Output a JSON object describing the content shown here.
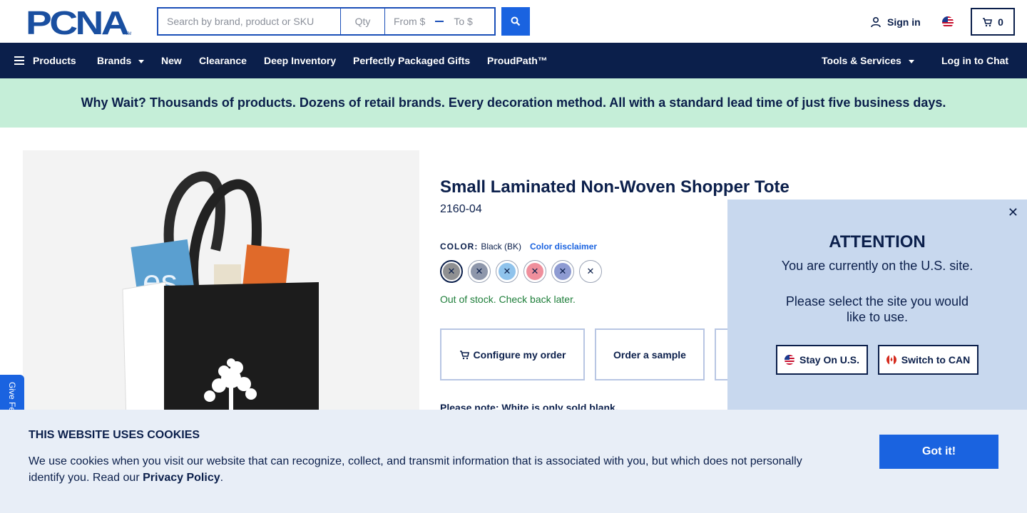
{
  "header": {
    "logo_text": "PCNA",
    "search_placeholder": "Search by brand, product or SKU",
    "qty_placeholder": "Qty",
    "price_from_placeholder": "From $",
    "price_to_placeholder": "To $",
    "sign_in_label": "Sign in",
    "cart_count": "0"
  },
  "nav": {
    "items": [
      "Products",
      "Brands",
      "New",
      "Clearance",
      "Deep Inventory",
      "Perfectly Packaged Gifts",
      "ProudPath™"
    ],
    "right_items": [
      "Tools & Services",
      "Log in to Chat"
    ]
  },
  "promo": {
    "text": "Why Wait? Thousands of products. Dozens of retail brands. Every decoration method. All with a standard lead time of just five business days."
  },
  "product": {
    "title": "Small Laminated Non-Woven Shopper Tote",
    "sku": "2160-04",
    "color_label": "COLOR:",
    "color_value": "Black (BK)",
    "color_disclaimer": "Color disclaimer",
    "swatch_colors": [
      "#8f9092",
      "#8e97ab",
      "#8fc3ec",
      "#ef8f9c",
      "#8e9bd2",
      "#ffffff"
    ],
    "stock_status": "Out of stock. Check back later.",
    "configure_label": "Configure my order",
    "sample_label": "Order a sample",
    "note": "Please note: White is only sold blank."
  },
  "feedback_label": "Give Feedback",
  "attention": {
    "title": "ATTENTION",
    "line1": "You are currently on the U.S. site.",
    "line2": "Please select the site you would like to use.",
    "stay_label": "Stay On U.S.",
    "switch_label": "Switch to CAN"
  },
  "cookie": {
    "title": "THIS WEBSITE USES COOKIES",
    "text_before": "We use cookies when you visit our website that can recognize, collect, and transmit information that is associated with you, but which does not personally identify you. Read our ",
    "link": "Privacy Policy",
    "text_after": ".",
    "button": "Got it!"
  },
  "colors": {
    "navy": "#0b1f4b",
    "accent_blue": "#1a63e0",
    "promo_bg": "#c5eed8",
    "stock_green": "#1e7e3a"
  }
}
